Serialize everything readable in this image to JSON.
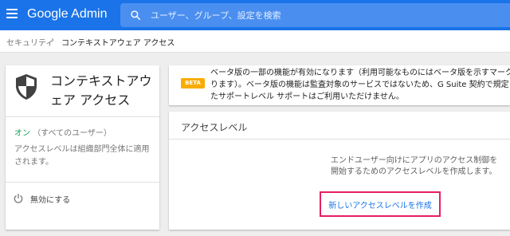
{
  "app": {
    "logo_text": "Google Admin"
  },
  "search": {
    "placeholder": "ユーザー、グループ、設定を検索"
  },
  "breadcrumb": {
    "parent": "セキュリティ",
    "separator": "›",
    "current": "コンテキストアウェア アクセス"
  },
  "sidebar_card": {
    "title": "コンテキストアウェア アクセス",
    "status_on": "オン",
    "status_scope": "（すべてのユーザー）",
    "description": "アクセスレベルは組織部門全体に適用されます。",
    "disable_label": "無効にする"
  },
  "beta_banner": {
    "badge": "BETA",
    "text": "ベータ版の一部の機能が有効になります（利用可能なものにはベータ版を示すマークがあります）。ベータ版の機能は監査対象のサービスではないため、G Suite 契約で規定されたサポートレベル サポートはご利用いただけません。"
  },
  "access_levels": {
    "title": "アクセスレベル",
    "empty_description": "エンドユーザー向けにアプリのアクセス制御を開始するためのアクセスレベルを作成します。",
    "create_button": "新しいアクセスレベルを作成"
  },
  "colors": {
    "brand": "#1a73e8",
    "status_on": "#0f9d58",
    "beta": "#f9ab00",
    "highlight": "#e91e63"
  }
}
